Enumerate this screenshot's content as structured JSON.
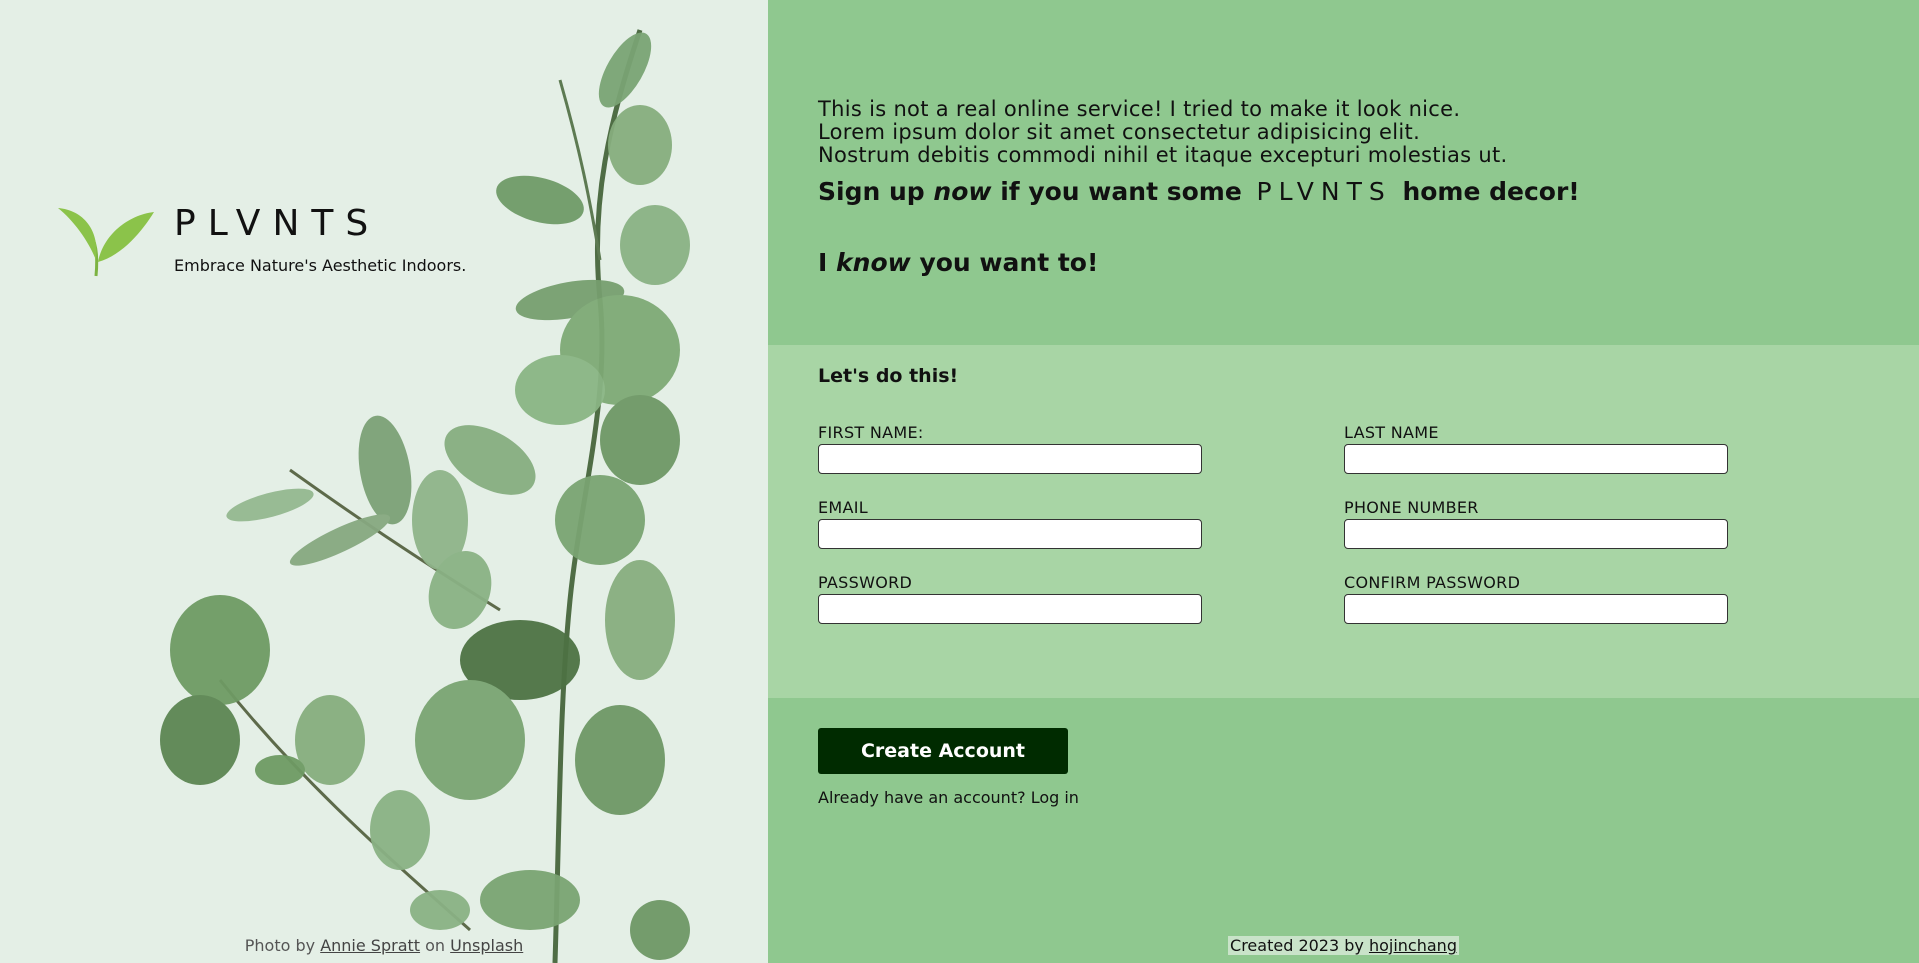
{
  "brand": {
    "name": "PLVNTS",
    "tagline": "Embrace Nature's Aesthetic Indoors."
  },
  "credit": {
    "prefix": "Photo by",
    "author": "Annie Spratt",
    "middle": "on",
    "site": "Unsplash"
  },
  "intro": {
    "line1": "This is not a real online service! I tried to make it look nice.",
    "line2": "Lorem ipsum dolor sit amet consectetur adipisicing elit.",
    "line3": "Nostrum debitis commodi nihil et itaque excepturi molestias ut.",
    "signup_a": "Sign up",
    "signup_now": "now",
    "signup_b": "if you want some",
    "signup_brand": "PLVNTS",
    "signup_c": "home decor!",
    "know_a": "I",
    "know_em": "know",
    "know_b": "you want to!"
  },
  "form": {
    "title": "Let's do this!",
    "fields": {
      "first_name": "FIRST NAME:",
      "last_name": "LAST NAME",
      "email": "EMAIL",
      "phone": "PHONE NUMBER",
      "password": "PASSWORD",
      "confirm_password": "CONFIRM PASSWORD"
    }
  },
  "actions": {
    "create_label": "Create Account",
    "login_prompt": "Already have an account?",
    "login_link": "Log in"
  },
  "footer": {
    "prefix": "Created 2023 by",
    "author": "hojinchang"
  },
  "colors": {
    "accent": "#8fc88f",
    "form_bg": "#a8d5a5",
    "button": "#002b00",
    "left_bg": "#e4efe6",
    "logo": "#8bc34a"
  }
}
